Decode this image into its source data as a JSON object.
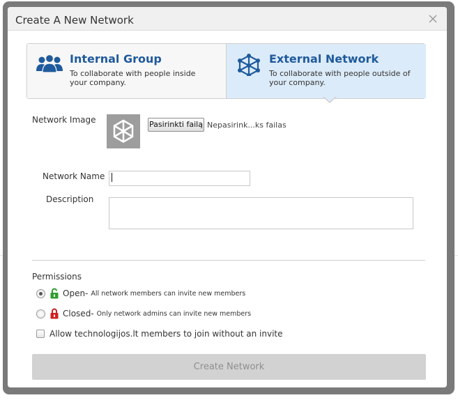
{
  "background": {
    "link_fragment": "og"
  },
  "dialog": {
    "title": "Create A New Network",
    "close_icon": "close-icon"
  },
  "network_types": [
    {
      "title": "Internal Group",
      "description": "To collaborate with people inside your company.",
      "icon": "people-group-icon",
      "selected": false
    },
    {
      "title": "External Network",
      "description": "To collaborate with people outside of your company.",
      "icon": "network-nodes-icon",
      "selected": true
    }
  ],
  "form": {
    "image_label": "Network Image",
    "image_icon": "network-nodes-icon",
    "file_button_label": "Pasirinkti failą",
    "file_status": "Nepasirink...ks failas",
    "name_label": "Network Name",
    "name_value": "",
    "description_label": "Description",
    "description_value": ""
  },
  "permissions": {
    "title": "Permissions",
    "options": [
      {
        "label": "Open-",
        "detail": "All network members can invite new members",
        "icon": "unlocked-icon",
        "checked": true
      },
      {
        "label": "Closed-",
        "detail": "Only network admins can invite new members",
        "icon": "locked-icon",
        "checked": false
      }
    ],
    "allow_join_label": "Allow technologijos.lt members to join without an invite",
    "allow_join_checked": false
  },
  "submit_label": "Create Network",
  "colors": {
    "accent_blue": "#1f5a9c",
    "selected_bg": "#dcebf9",
    "unlocked_green": "#2e9e2e",
    "locked_red": "#d02020",
    "disabled_button": "#d2d2d2"
  }
}
